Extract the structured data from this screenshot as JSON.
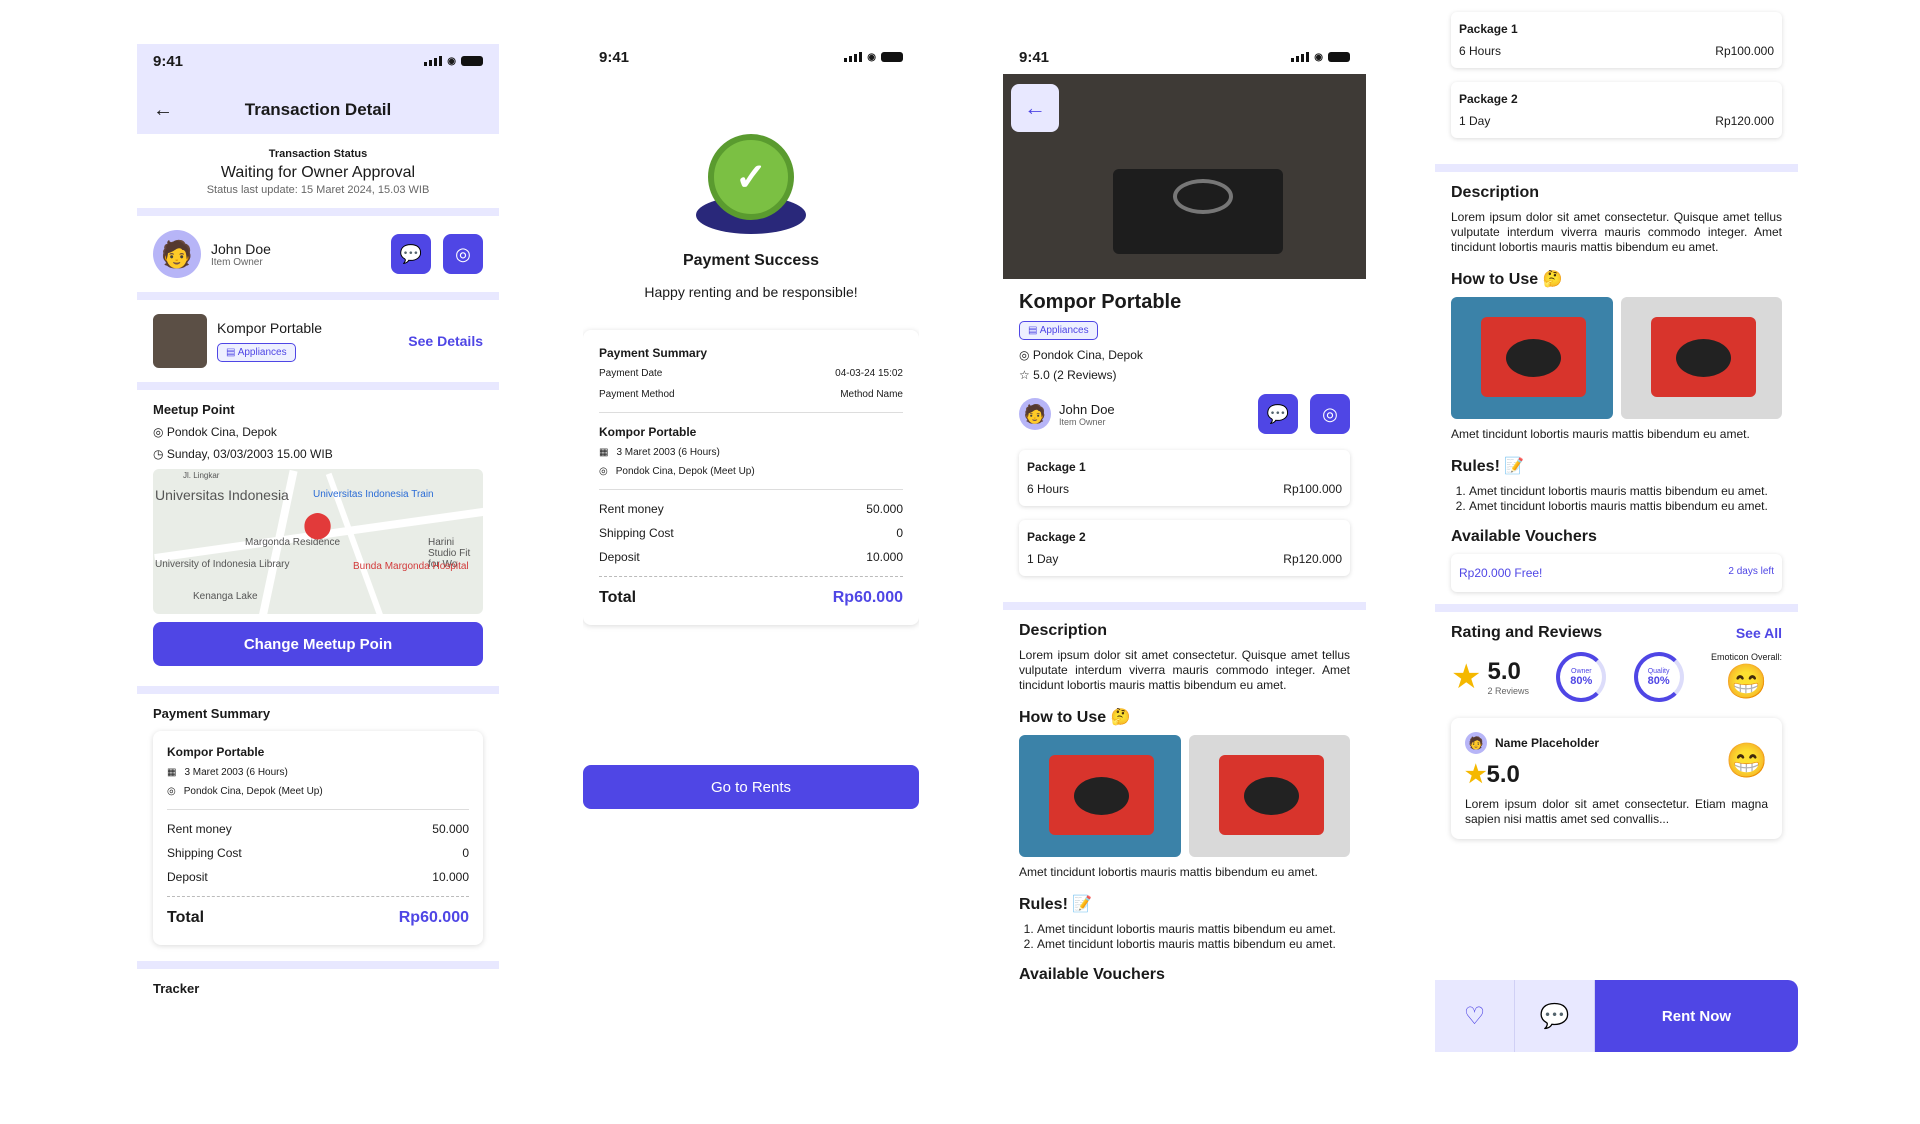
{
  "s1": {
    "time": "9:41",
    "title": "Transaction Detail",
    "status_label": "Transaction Status",
    "status_value": "Waiting for Owner Approval",
    "status_update": "Status last update: 15 Maret 2024, 15.03 WIB",
    "owner_name": "John Doe",
    "owner_role": "Item Owner",
    "item_name": "Kompor Portable",
    "item_category": "Appliances",
    "see_details": "See Details",
    "meetup_title": "Meetup Point",
    "meetup_location": "Pondok Cina, Depok",
    "meetup_time": "Sunday, 03/03/2003 15.00 WIB",
    "map_labels": [
      "Universitas Indonesia",
      "Universitas Indonesia Train",
      "Margonda Residence",
      "Harini Studio Fit for Wo",
      "University of Indonesia Library",
      "Bunda Margonda Hospital",
      "Kenanga Lake",
      "Jl. Lingkar"
    ],
    "change_meetup": "Change Meetup Poin",
    "payment_title": "Payment Summary",
    "summary_item": "Kompor Portable",
    "summary_date": "3 Maret 2003 (6 Hours)",
    "summary_location": "Pondok Cina, Depok (Meet Up)",
    "rent_label": "Rent money",
    "rent_value": "50.000",
    "shipping_label": "Shipping Cost",
    "shipping_value": "0",
    "deposit_label": "Deposit",
    "deposit_value": "10.000",
    "total_label": "Total",
    "total_value": "Rp60.000",
    "tracker": "Tracker"
  },
  "s2": {
    "time": "9:41",
    "title": "Payment Success",
    "subtitle": "Happy renting and be responsible!",
    "summary_title": "Payment Summary",
    "date_label": "Payment Date",
    "date_value": "04-03-24 15:02",
    "method_label": "Payment Method",
    "method_value": "Method Name",
    "item": "Kompor Portable",
    "item_date": "3 Maret 2003 (6 Hours)",
    "item_location": "Pondok Cina, Depok (Meet Up)",
    "rent_label": "Rent money",
    "rent_value": "50.000",
    "shipping_label": "Shipping Cost",
    "shipping_value": "0",
    "deposit_label": "Deposit",
    "deposit_value": "10.000",
    "total_label": "Total",
    "total_value": "Rp60.000",
    "cta": "Go to Rents"
  },
  "s3": {
    "time": "9:41",
    "name": "Kompor Portable",
    "category": "Appliances",
    "location": "Pondok Cina, Depok",
    "rating": "5.0 (2 Reviews)",
    "owner_name": "John Doe",
    "owner_role": "Item Owner",
    "packages": [
      {
        "title": "Package 1",
        "duration": "6 Hours",
        "price": "Rp100.000"
      },
      {
        "title": "Package 2",
        "duration": "1 Day",
        "price": "Rp120.000"
      }
    ],
    "desc_title": "Description",
    "desc": "Lorem ipsum dolor sit amet consectetur. Quisque amet tellus vulputate interdum viverra mauris commodo integer. Amet tincidunt lobortis mauris mattis bibendum eu amet.",
    "howto_title": "How to Use 🤔",
    "howto_caption": "Amet tincidunt lobortis mauris mattis bibendum eu amet.",
    "rules_title": "Rules! 📝",
    "rules": [
      "Amet tincidunt lobortis mauris mattis bibendum eu amet.",
      "Amet tincidunt lobortis mauris mattis bibendum eu amet."
    ],
    "vouchers_title": "Available Vouchers"
  },
  "s4": {
    "packages": [
      {
        "title": "Package 1",
        "duration": "6 Hours",
        "price": "Rp100.000"
      },
      {
        "title": "Package 2",
        "duration": "1 Day",
        "price": "Rp120.000"
      }
    ],
    "desc_title": "Description",
    "desc": "Lorem ipsum dolor sit amet consectetur. Quisque amet tellus vulputate interdum viverra mauris commodo integer. Amet tincidunt lobortis mauris mattis bibendum eu amet.",
    "howto_title": "How to Use 🤔",
    "howto_caption": "Amet tincidunt lobortis mauris mattis bibendum eu amet.",
    "rules_title": "Rules! 📝",
    "rules": [
      "Amet tincidunt lobortis mauris mattis bibendum eu amet.",
      "Amet tincidunt lobortis mauris mattis bibendum eu amet."
    ],
    "vouchers_title": "Available Vouchers",
    "voucher_text": "Rp20.000 Free!",
    "voucher_left": "2 days left",
    "ratings_title": "Rating and Reviews",
    "see_all": "See All",
    "rating_value": "5.0",
    "rating_count": "2 Reviews",
    "owner_ring_label": "Owner",
    "owner_ring_value": "80%",
    "quality_ring_label": "Quality",
    "quality_ring_value": "80%",
    "emoticon_label": "Emoticon Overall:",
    "review_name": "Name Placeholder",
    "review_rating": "5.0",
    "review_text": "Lorem ipsum dolor sit amet consectetur. Etiam magna sapien nisi mattis amet sed convallis...",
    "rent_now": "Rent Now"
  }
}
